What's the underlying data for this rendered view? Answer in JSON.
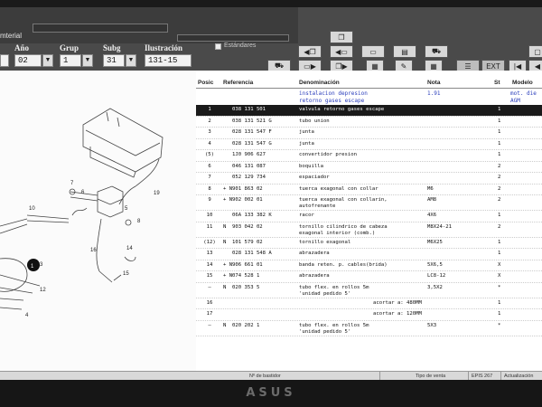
{
  "header": {
    "top_text": "mterial",
    "labels": {
      "year": "Año",
      "group": "Grup",
      "subgroup": "Subg",
      "illustration": "Ilustración"
    },
    "values": {
      "year": "02",
      "group": "1",
      "subgroup": "31",
      "illustration": "131-15"
    },
    "checkbox_label": "Estándares",
    "ext_label": "EXT"
  },
  "table": {
    "headers": {
      "pos": "Posic",
      "ref": "Referencia",
      "name": "Denominación",
      "nota": "Nota",
      "st": "St",
      "model": "Modelo"
    },
    "subtitle_lines": [
      "instalacion depresion",
      "retorno gases escape"
    ],
    "subtitle_nota": "1.91",
    "subtitle_model": [
      "mot. die",
      "AGM"
    ],
    "rows": [
      {
        "pos": "1",
        "mark": "",
        "ref": "038 131 501",
        "name": "valvula retorno gases escape",
        "nota": "",
        "st": "1",
        "selected": true
      },
      {
        "pos": "2",
        "mark": "",
        "ref": "038 131 521 G",
        "name": "tubo union",
        "nota": "",
        "st": "1"
      },
      {
        "pos": "3",
        "mark": "",
        "ref": "028 131 547 F",
        "name": "junta",
        "nota": "",
        "st": "1"
      },
      {
        "pos": "4",
        "mark": "",
        "ref": "028 131 547 G",
        "name": "junta",
        "nota": "",
        "st": "1"
      },
      {
        "pos": "(5)",
        "mark": "",
        "ref": "1J0 906 627",
        "name": "convertidor presion",
        "nota": "",
        "st": "1"
      },
      {
        "pos": "6",
        "mark": "",
        "ref": "046 131 087",
        "name": "boquilla",
        "nota": "",
        "st": "2"
      },
      {
        "pos": "7",
        "mark": "",
        "ref": "052 129 734",
        "name": "espaciador",
        "nota": "",
        "st": "2"
      },
      {
        "pos": "8",
        "mark": "+ N",
        "ref": "901 863 02",
        "name": "tuerca exagonal con collar",
        "nota": "M6",
        "st": "2"
      },
      {
        "pos": "9",
        "mark": "+ N",
        "ref": "902 002 01",
        "name": "tuerca exagonal con collarin,",
        "name2": "autofrenante",
        "nota": "AM8",
        "st": "2"
      },
      {
        "pos": "10",
        "mark": "",
        "ref": "06A 133 382 K",
        "name": "racor",
        "nota": "4X6",
        "st": "1"
      },
      {
        "pos": "11",
        "mark": "N",
        "ref": "903 042 02",
        "name": "tornillo cilindrico de cabeza",
        "name2": "exagonal interior (comb.)",
        "nota": "M8X24-21",
        "st": "2"
      },
      {
        "pos": "(12)",
        "mark": "N",
        "ref": "101 579 02",
        "name": "tornillo exagonal",
        "nota": "M6X25",
        "st": "1"
      },
      {
        "pos": "13",
        "mark": "",
        "ref": "028 131 548 A",
        "name": "abrazadera",
        "nota": "",
        "st": "1"
      },
      {
        "pos": "14",
        "mark": "+ N",
        "ref": "906 661 01",
        "name": "banda reten. p. cables(brida)",
        "nota": "5X6,5",
        "st": "X"
      },
      {
        "pos": "15",
        "mark": "+ N",
        "ref": "074 528 1",
        "name": "abrazadera",
        "nota": "LC8-12",
        "st": "X"
      },
      {
        "pos": "–",
        "mark": "N",
        "ref": "020 353 5",
        "name": "tubo flex. en rollos 5m",
        "name2": "'unidad pedido 5'",
        "nota": "3,5X2",
        "st": "*"
      },
      {
        "pos": "16",
        "mark": "",
        "ref": "",
        "name": "",
        "name_right": "acortar a: 480MM",
        "nota": "",
        "st": "1"
      },
      {
        "pos": "17",
        "mark": "",
        "ref": "",
        "name": "",
        "name_right": "acortar a: 120MM",
        "nota": "",
        "st": "1"
      },
      {
        "pos": "–",
        "mark": "N",
        "ref": "020 202 1",
        "name": "tubo flex. en rollos 5m",
        "name2": "'unidad pedido 5'",
        "nota": "5X3",
        "st": "*"
      }
    ]
  },
  "diagram": {
    "callouts": [
      "19",
      "10",
      "7",
      "5",
      "8",
      "6",
      "1",
      "3",
      "12",
      "4",
      "16",
      "14",
      "15"
    ]
  },
  "status": {
    "bastidor": "Nº de bastidor",
    "venta": "Tipo de venta",
    "epis": "EPIS 267",
    "update": "Actualización"
  },
  "brand": "ASUS",
  "colors": {
    "toolbar": "#4a4a4a",
    "selected_row": "#1a1a1a",
    "subtitle_blue": "#2a3dbb"
  }
}
